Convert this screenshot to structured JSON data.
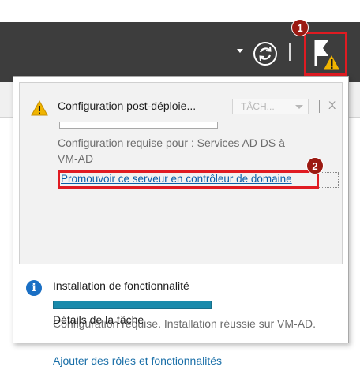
{
  "colors": {
    "toolbar_bg": "#3d3d3d",
    "highlight_red": "#e01b22",
    "callout_bg": "#9b1a12",
    "link_blue": "#0a5ea8",
    "progress_teal": "#1a8aab",
    "warning_yellow": "#f0b400",
    "info_blue": "#1a6fc4"
  },
  "toolbar": {
    "dropdown_icon": "caret-down",
    "refresh_icon": "refresh-circle",
    "notifications_icon": "flag-with-warning"
  },
  "callouts": {
    "one": "1",
    "two": "2"
  },
  "notifications": [
    {
      "icon": "warning-triangle",
      "title": "Configuration post-déploie...",
      "task_button": "TÂCH...",
      "close": "X",
      "progress": 0.0,
      "description": "Configuration requise pour : Services AD DS à VM-AD",
      "link": "Promouvoir ce serveur en contrôleur de domaine"
    },
    {
      "icon": "info-circle",
      "title": "Installation de fonctionnalité",
      "progress": 1.0,
      "description": "Configuration requise. Installation réussie sur VM-AD.",
      "link": "Ajouter des rôles et fonctionnalités"
    }
  ],
  "footer": {
    "details_label": "Détails de la tâche"
  }
}
